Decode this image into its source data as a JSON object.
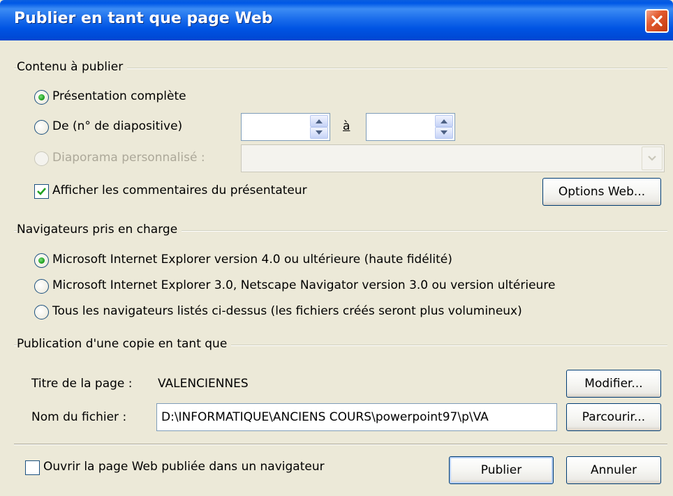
{
  "window": {
    "title": "Publier en tant que page Web"
  },
  "contenu": {
    "group_label": "Contenu à publier",
    "presentation_complete": {
      "label": "Présentation complète",
      "selected": true
    },
    "de": {
      "label": "De (n° de diapositive)",
      "from_value": "",
      "to_label": "à",
      "to_value": ""
    },
    "diaporama": {
      "label": "Diaporama personnalisé :",
      "value": "",
      "disabled": true
    },
    "afficher_commentaires": {
      "label": "Afficher les commentaires du présentateur",
      "checked": true
    },
    "options_web_button": "Options Web..."
  },
  "navigateurs": {
    "group_label": "Navigateurs pris en charge",
    "options": [
      {
        "label": "Microsoft Internet Explorer version 4.0 ou ultérieure (haute fidélité)",
        "selected": true
      },
      {
        "label": "Microsoft Internet Explorer 3.0, Netscape Navigator version 3.0 ou version ultérieure",
        "selected": false
      },
      {
        "label": "Tous les navigateurs listés ci-dessus (les fichiers créés seront plus volumineux)",
        "selected": false
      }
    ]
  },
  "publication": {
    "group_label": "Publication d'une copie en tant que",
    "titre_label": "Titre de la page :",
    "titre_value": "VALENCIENNES",
    "modifier_button": "Modifier...",
    "nom_fichier_label": "Nom du fichier :",
    "nom_fichier_value": "D:\\INFORMATIQUE\\ANCIENS COURS\\powerpoint97\\p\\VA",
    "parcourir_button": "Parcourir..."
  },
  "footer": {
    "ouvrir_label": "Ouvrir la page Web publiée dans un navigateur",
    "ouvrir_checked": false,
    "publier_button": "Publier",
    "annuler_button": "Annuler"
  },
  "colors": {
    "titlebar": "#0054E3",
    "dialog_bg": "#ECE9D8",
    "radio_dot": "#21A121",
    "close": "#E25A2E"
  }
}
